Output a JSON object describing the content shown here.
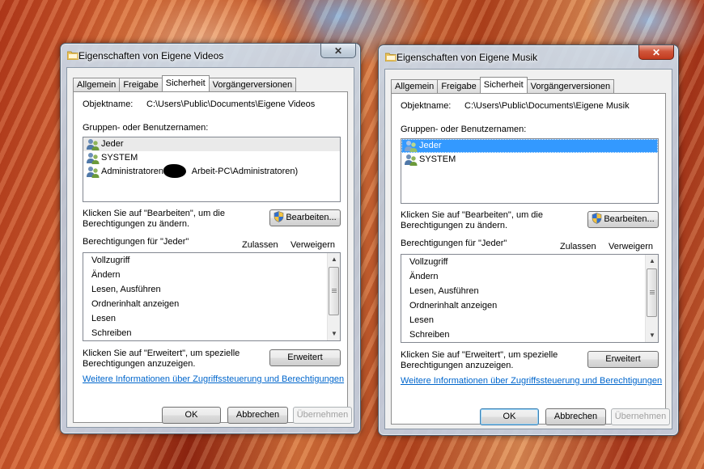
{
  "dialogs": [
    {
      "title": "Eigenschaften von Eigene Videos",
      "close_label": "✕",
      "tabs": [
        "Allgemein",
        "Freigabe",
        "Sicherheit",
        "Vorgängerversionen"
      ],
      "object_label": "Objektname:",
      "object_path": "C:\\Users\\Public\\Documents\\Eigene Videos",
      "groups_label": "Gruppen- oder Benutzernamen:",
      "users": [
        "Jeder",
        "SYSTEM",
        "Administratoren (",
        "Arbeit-PC\\Administratoren)"
      ],
      "edit_hint_1": "Klicken Sie auf \"Bearbeiten\", um die",
      "edit_hint_2": "Berechtigungen zu ändern.",
      "edit_button": "Bearbeiten...",
      "perms_for": "Berechtigungen für \"Jeder\"",
      "allow_label": "Zulassen",
      "deny_label": "Verweigern",
      "permissions": [
        "Vollzugriff",
        "Ändern",
        "Lesen, Ausführen",
        "Ordnerinhalt anzeigen",
        "Lesen",
        "Schreiben"
      ],
      "adv_hint_1": "Klicken Sie auf \"Erweitert\", um spezielle",
      "adv_hint_2": "Berechtigungen anzuzeigen.",
      "advanced_button": "Erweitert",
      "info_link": "Weitere Informationen über Zugriffssteuerung und Berechtigungen",
      "ok_button": "OK",
      "cancel_button": "Abbrechen",
      "apply_button": "Übernehmen"
    },
    {
      "title": "Eigenschaften von Eigene Musik",
      "close_label": "✕",
      "tabs": [
        "Allgemein",
        "Freigabe",
        "Sicherheit",
        "Vorgängerversionen"
      ],
      "object_label": "Objektname:",
      "object_path": "C:\\Users\\Public\\Documents\\Eigene Musik",
      "groups_label": "Gruppen- oder Benutzernamen:",
      "users": [
        "Jeder",
        "SYSTEM"
      ],
      "edit_hint_1": "Klicken Sie auf \"Bearbeiten\", um die",
      "edit_hint_2": "Berechtigungen zu ändern.",
      "edit_button": "Bearbeiten...",
      "perms_for": "Berechtigungen für \"Jeder\"",
      "allow_label": "Zulassen",
      "deny_label": "Verweigern",
      "permissions": [
        "Vollzugriff",
        "Ändern",
        "Lesen, Ausführen",
        "Ordnerinhalt anzeigen",
        "Lesen",
        "Schreiben"
      ],
      "adv_hint_1": "Klicken Sie auf \"Erweitert\", um spezielle",
      "adv_hint_2": "Berechtigungen anzuzeigen.",
      "advanced_button": "Erweitert",
      "info_link": "Weitere Informationen über Zugriffssteuerung und Berechtigungen",
      "ok_button": "OK",
      "cancel_button": "Abbrechen",
      "apply_button": "Übernehmen"
    }
  ],
  "icons": {
    "folder": "folder-icon",
    "user_group": "user-group-icon",
    "uac_shield": "uac-shield-icon"
  },
  "colors": {
    "selection": "#3399ff",
    "link": "#0066cc",
    "close_active": "#c23b1e"
  }
}
